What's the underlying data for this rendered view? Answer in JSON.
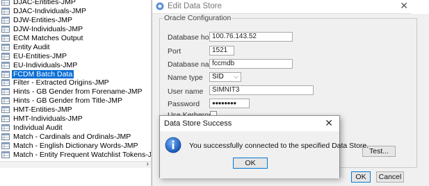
{
  "tree": {
    "items": [
      {
        "label": "DJAC-Entities-JMP",
        "selected": false
      },
      {
        "label": "DJAC-Individuals-JMP",
        "selected": false
      },
      {
        "label": "DJW-Entities-JMP",
        "selected": false
      },
      {
        "label": "DJW-Individuals-JMP",
        "selected": false
      },
      {
        "label": "ECM Matches Output",
        "selected": false
      },
      {
        "label": "Entity Audit",
        "selected": false
      },
      {
        "label": "EU-Entities-JMP",
        "selected": false
      },
      {
        "label": "EU-Individuals-JMP",
        "selected": false
      },
      {
        "label": "FCDM Batch Data",
        "selected": true
      },
      {
        "label": "Filter - Extracted Origins-JMP",
        "selected": false
      },
      {
        "label": "Hints - GB Gender from Forename-JMP",
        "selected": false
      },
      {
        "label": "Hints - GB Gender from Title-JMP",
        "selected": false
      },
      {
        "label": "HMT-Entities-JMP",
        "selected": false
      },
      {
        "label": "HMT-Individuals-JMP",
        "selected": false
      },
      {
        "label": "Individual Audit",
        "selected": false
      },
      {
        "label": "Match - Cardinals and Ordinals-JMP",
        "selected": false
      },
      {
        "label": "Match - English Dictionary Words-JMP",
        "selected": false
      },
      {
        "label": "Match - Entity Frequent Watchlist Tokens-JMP",
        "selected": false
      }
    ],
    "scroll_arrow": "›"
  },
  "edit_window": {
    "title": "Edit Data Store",
    "close_glyph": "✕",
    "group_title": "Oracle Configuration",
    "fields": {
      "host_label": "Database host",
      "host_value": "100.76.143.52",
      "port_label": "Port",
      "port_value": "1521",
      "dbname_label": "Database name",
      "dbname_value": "fccmdb",
      "nametype_label": "Name type",
      "nametype_value": "SID",
      "username_label": "User name",
      "username_value": "SIMNIT3",
      "password_label": "Password",
      "password_value": "●●●●●●●●",
      "kerberos_label": "Use Kerberos"
    },
    "test_label": "Test...",
    "ok_label": "OK",
    "cancel_label": "Cancel"
  },
  "success_dialog": {
    "title": "Data Store Success",
    "close_glyph": "✕",
    "message": "You successfully connected to the specified Data Store.",
    "ok_label": "OK",
    "icon": "info-icon"
  },
  "colors": {
    "selection": "#0a6fd6",
    "info_blue": "#1f6fd1",
    "primary_border": "#0078d7"
  }
}
